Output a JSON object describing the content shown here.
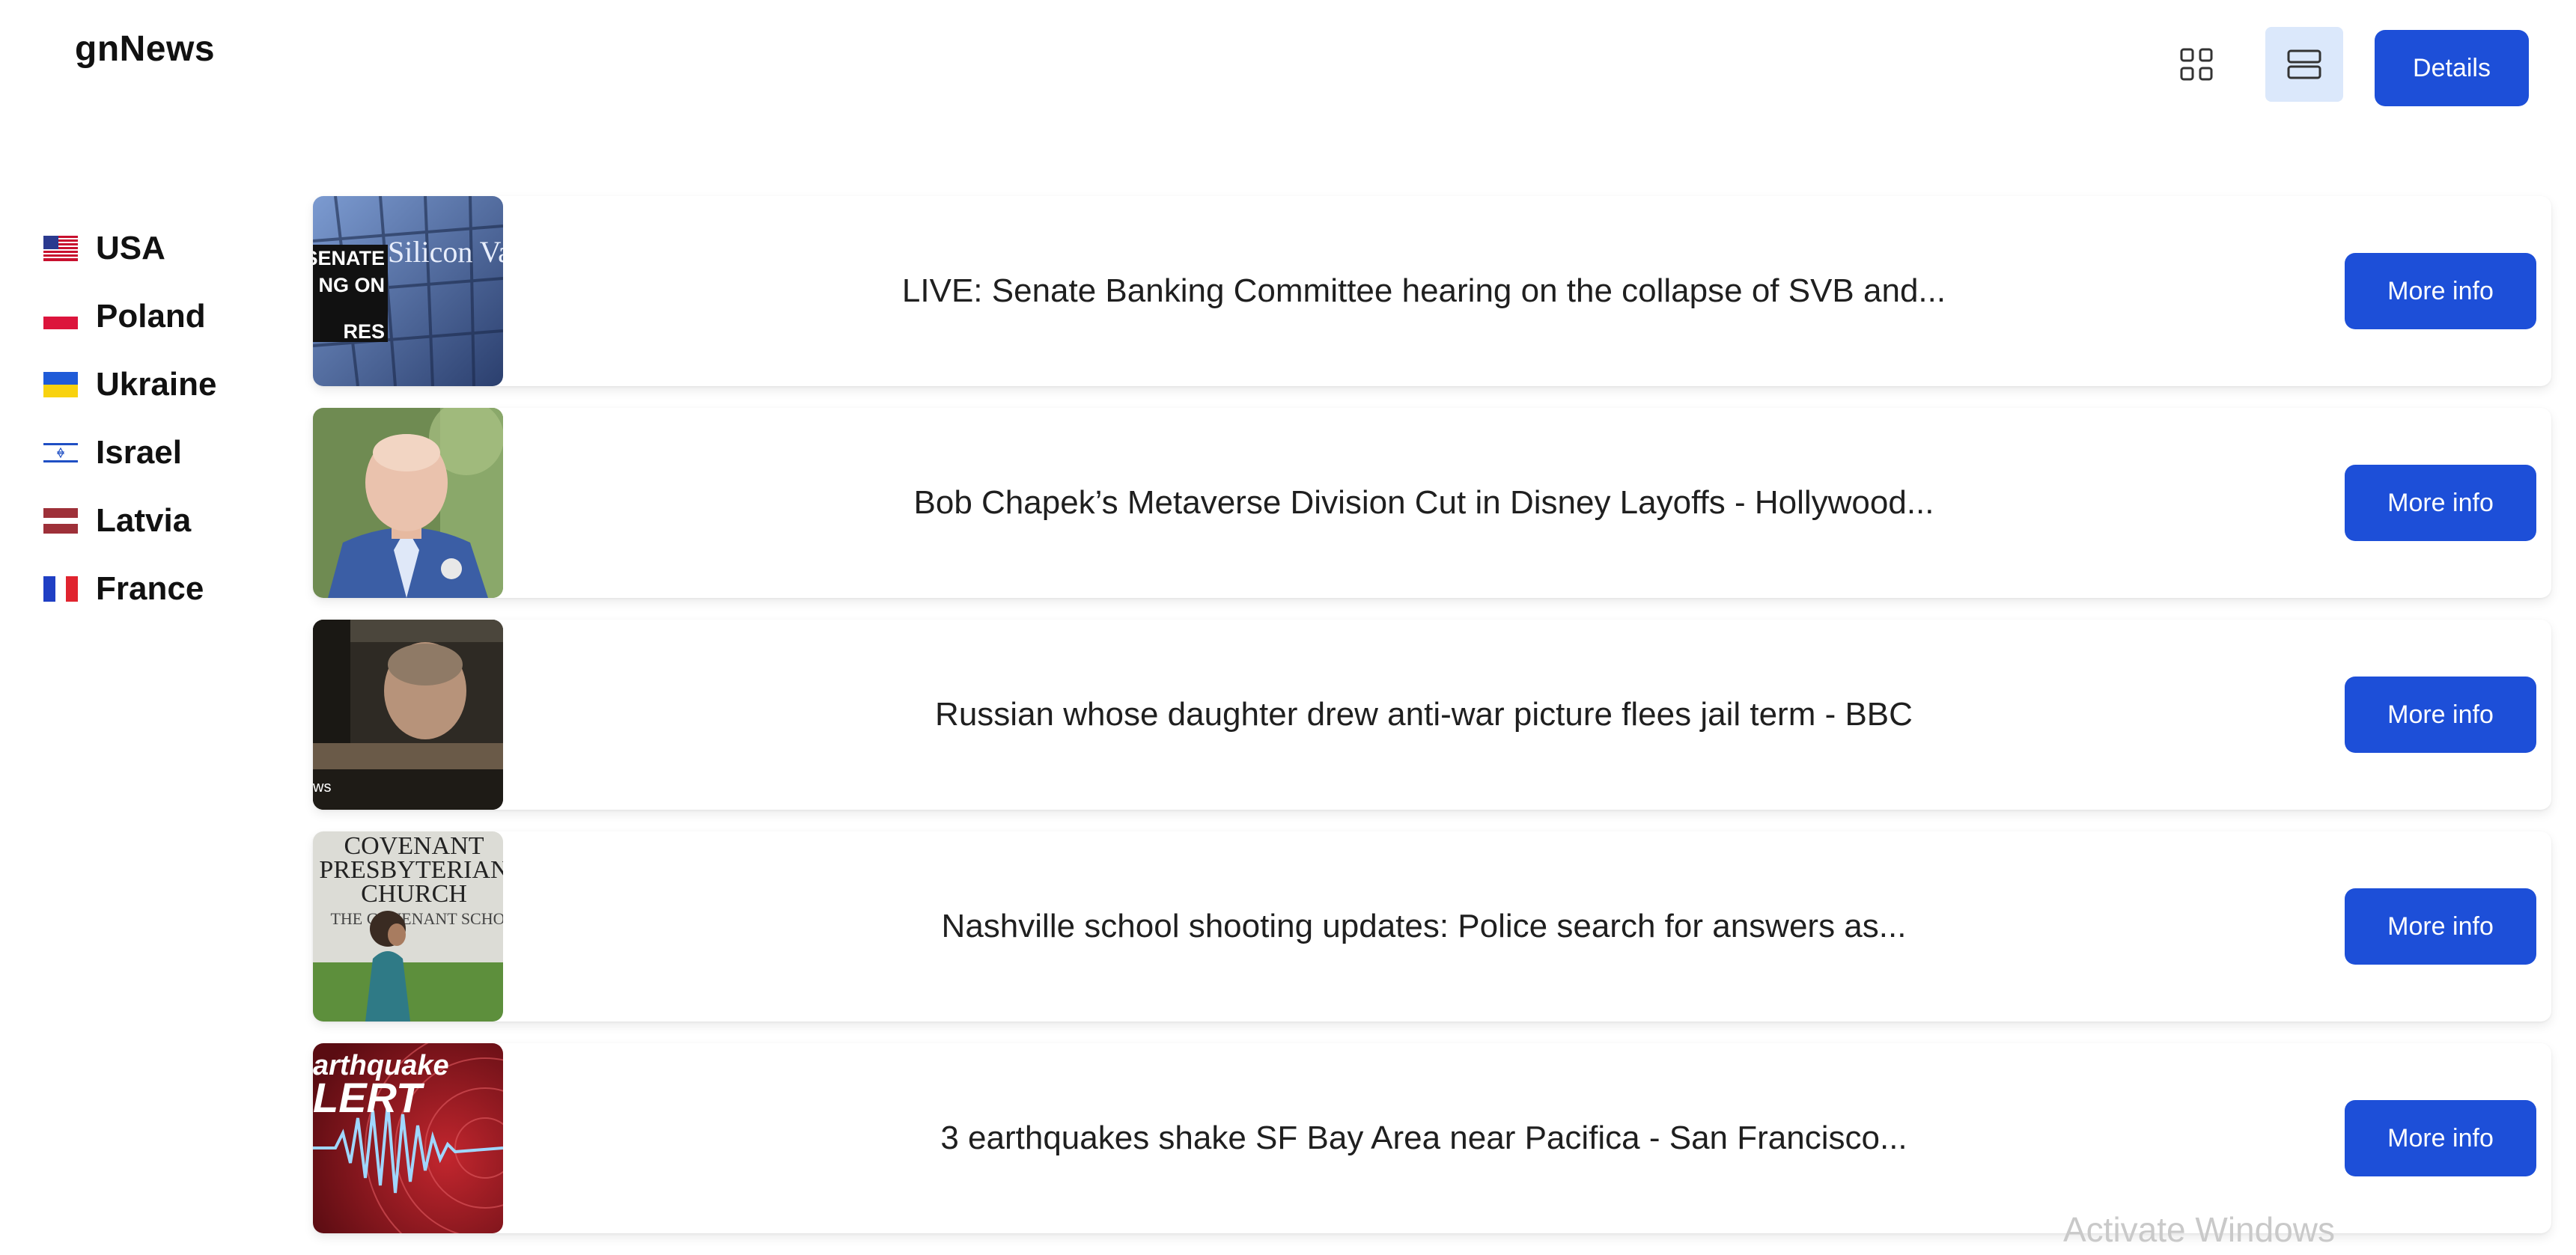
{
  "app": {
    "title": "gnNews"
  },
  "toolbar": {
    "grid_icon": "grid-view-icon",
    "list_icon": "list-view-icon",
    "details_label": "Details"
  },
  "sidebar": {
    "countries": [
      {
        "label": "USA",
        "flag": "usa-flag-icon"
      },
      {
        "label": "Poland",
        "flag": "poland-flag-icon"
      },
      {
        "label": "Ukraine",
        "flag": "ukraine-flag-icon"
      },
      {
        "label": "Israel",
        "flag": "israel-flag-icon"
      },
      {
        "label": "Latvia",
        "flag": "latvia-flag-icon"
      },
      {
        "label": "France",
        "flag": "france-flag-icon"
      }
    ]
  },
  "articles": [
    {
      "title": "LIVE: Senate Banking Committee hearing on the collapse of SVB and...",
      "button": "More info",
      "thumb_text": [
        "SENATE",
        "NG ON",
        "RES"
      ],
      "thumb_sign": "Silicon Vall"
    },
    {
      "title": "Bob Chapek’s Metaverse Division Cut in Disney Layoffs - Hollywood...",
      "button": "More info"
    },
    {
      "title": "Russian whose daughter drew anti-war picture flees jail term - BBC",
      "button": "More info",
      "thumb_text": "ws"
    },
    {
      "title": "Nashville school shooting updates: Police search for answers as...",
      "button": "More info",
      "thumb_text": [
        "COVENANT",
        "PRESBYTERIAN",
        "CHURCH",
        "THE COVENANT SCHO"
      ]
    },
    {
      "title": "3 earthquakes shake SF Bay Area near Pacifica - San Francisco...",
      "button": "More info",
      "thumb_text": [
        "arthquake",
        "LERT"
      ]
    }
  ],
  "system": {
    "watermark": "Activate Windows"
  },
  "colors": {
    "accent": "#1d4fd8",
    "list_view_active": "#dbe8fb"
  }
}
